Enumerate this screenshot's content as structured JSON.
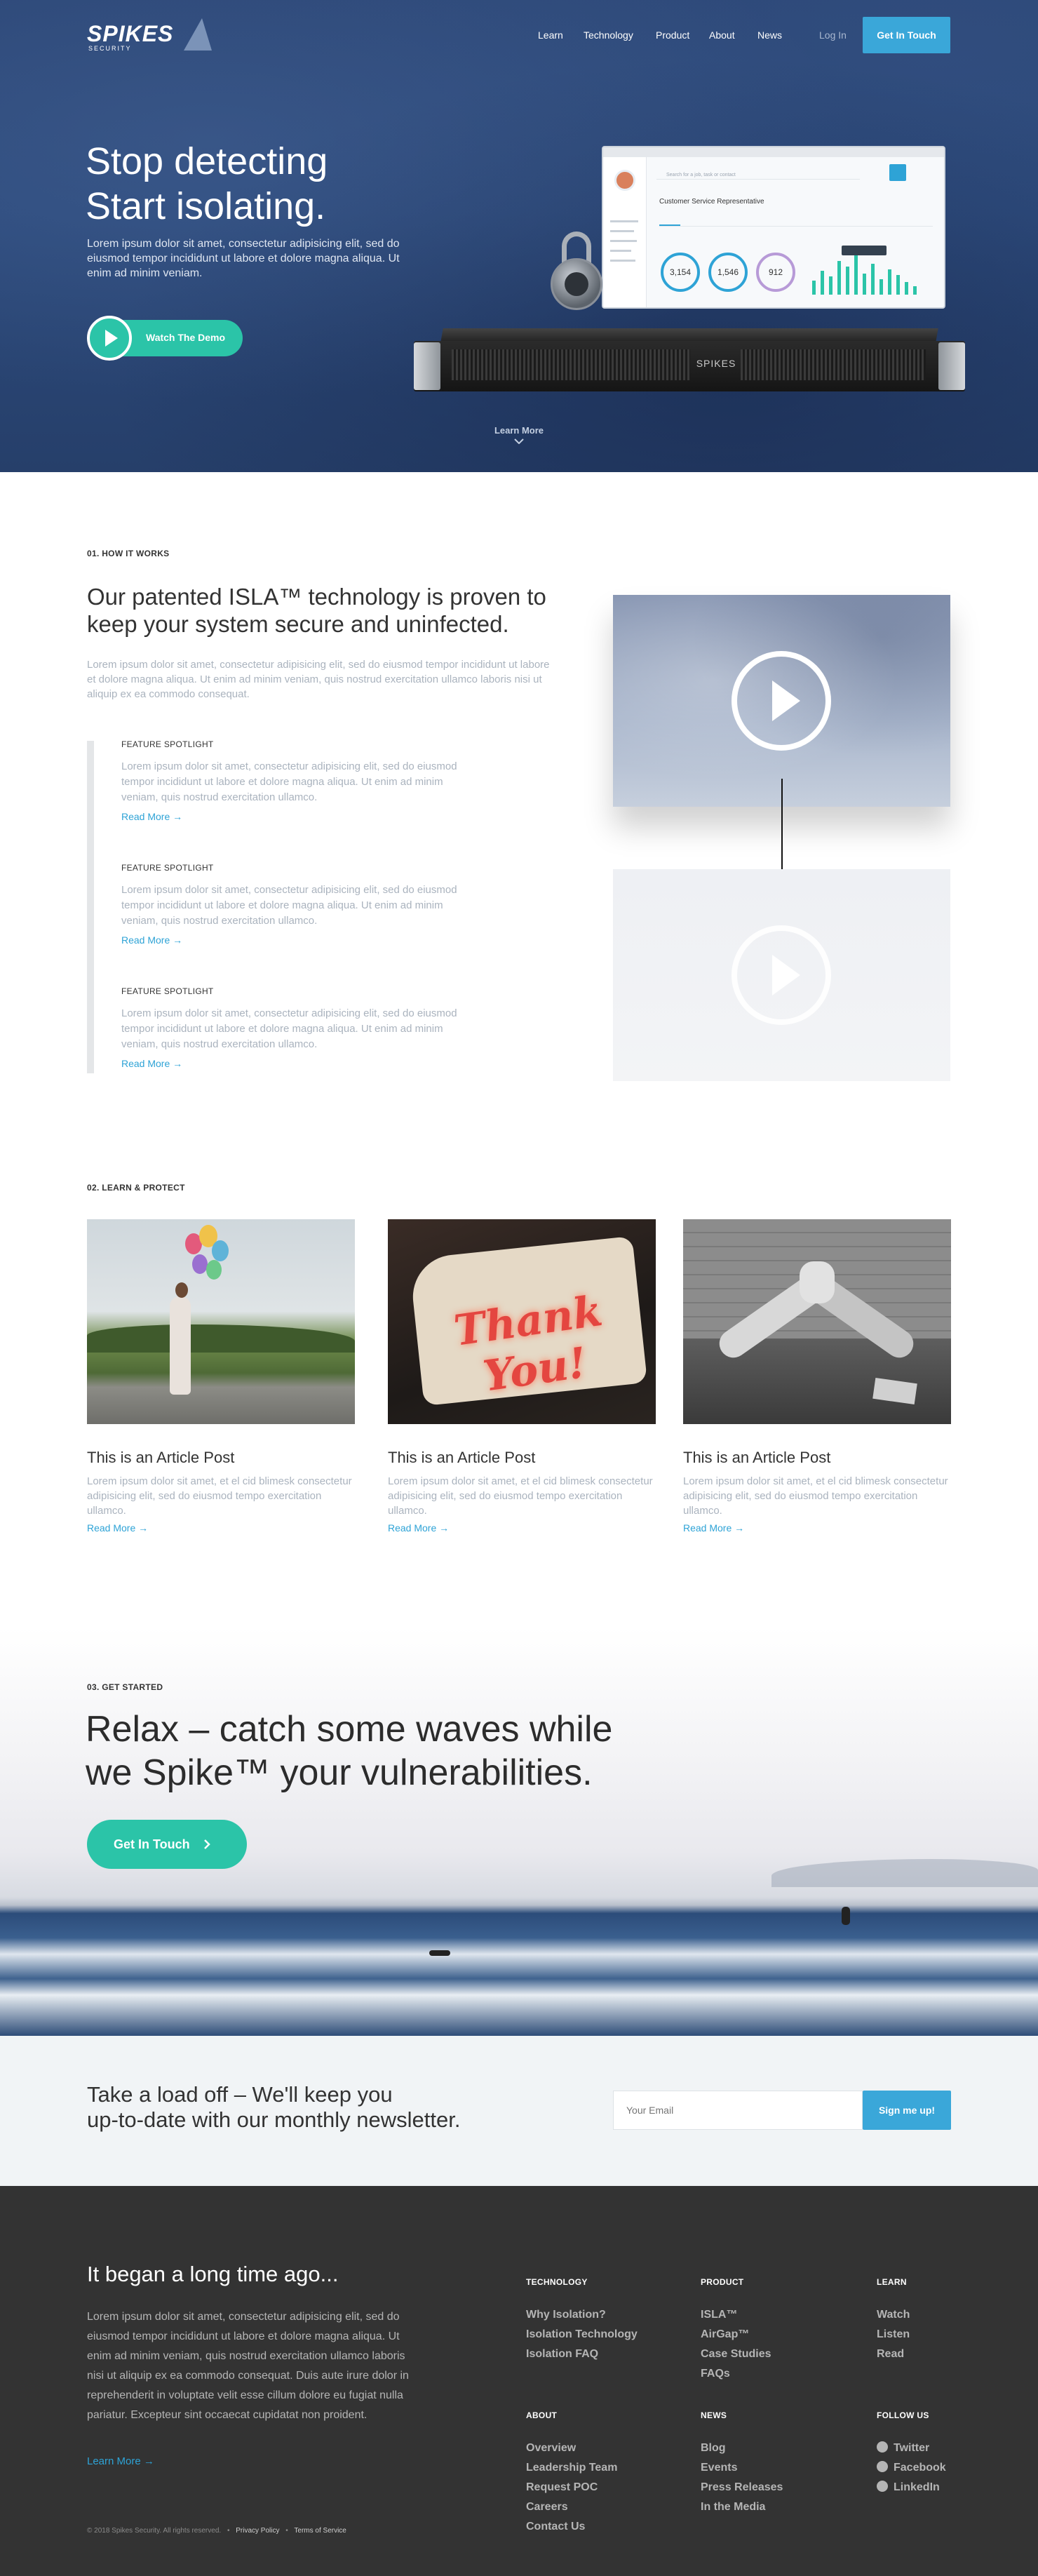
{
  "brand": {
    "name": "SPIKES",
    "sub": "SECURITY"
  },
  "nav": {
    "items": [
      "Learn",
      "Technology",
      "Product",
      "About",
      "News"
    ],
    "login": "Log In",
    "cta": "Get In Touch"
  },
  "hero": {
    "title1": "Stop detecting",
    "title2": "Start isolating.",
    "lead": "Lorem ipsum dolor sit amet, consectetur adipisicing elit, sed do eiusmod tempor incididunt ut labore et dolore magna aliqua. Ut enim ad minim veniam.",
    "demo": "Watch The Demo",
    "learn_more": "Learn More",
    "app": {
      "search": "Search for a job, task or contact",
      "title": "Customer Service Representative",
      "stats": [
        "3,154",
        "1,546",
        "912"
      ],
      "device_label": "SPIKES"
    }
  },
  "how": {
    "label": "01. HOW IT WORKS",
    "title": "Our patented ISLA™ technology is proven to keep your system secure and uninfected.",
    "body": "Lorem ipsum dolor sit amet, consectetur adipisicing elit, sed do eiusmod tempor incididunt ut labore et dolore magna aliqua. Ut enim ad minim veniam, quis nostrud exercitation ullamco laboris nisi ut aliquip ex ea commodo consequat.",
    "features": [
      {
        "title": "FEATURE SPOTLIGHT",
        "body": "Lorem ipsum dolor sit amet, consectetur adipisicing elit, sed do eiusmod tempor incididunt ut labore et dolore magna aliqua. Ut enim ad minim veniam, quis nostrud exercitation ullamco.",
        "link": "Read More →"
      },
      {
        "title": "FEATURE SPOTLIGHT",
        "body": "Lorem ipsum dolor sit amet, consectetur adipisicing elit, sed do eiusmod tempor incididunt ut labore et dolore magna aliqua. Ut enim ad minim veniam, quis nostrud exercitation ullamco.",
        "link": "Read More →"
      },
      {
        "title": "FEATURE SPOTLIGHT",
        "body": "Lorem ipsum dolor sit amet, consectetur adipisicing elit, sed do eiusmod tempor incididunt ut labore et dolore magna aliqua. Ut enim ad minim veniam, quis nostrud exercitation ullamco.",
        "link": "Read More →"
      }
    ]
  },
  "learn": {
    "label": "02. LEARN & PROTECT",
    "articles": [
      {
        "title": "This is an Article Post",
        "body": "Lorem ipsum dolor sit amet, et el cid blimesk consectetur adipisicing elit, sed do eiusmod tempo exercitation ullamco.",
        "link": "Read More →"
      },
      {
        "title": "This is an Article Post",
        "body": "Lorem ipsum dolor sit amet, et el cid blimesk consectetur adipisicing elit, sed do eiusmod tempo exercitation ullamco.",
        "link": "Read More →",
        "sign": "Thank You!"
      },
      {
        "title": "This is an Article Post",
        "body": "Lorem ipsum dolor sit amet, et el cid blimesk consectetur adipisicing elit, sed do eiusmod tempo exercitation ullamco.",
        "link": "Read More →"
      }
    ]
  },
  "started": {
    "label": "03. GET STARTED",
    "line1": "Relax – catch some waves while",
    "line2": "we Spike™ your vulnerabilities.",
    "cta": "Get In Touch"
  },
  "newsletter": {
    "line1": "Take a load off – We'll keep you",
    "line2": "up-to-date with our monthly newsletter.",
    "placeholder": "Your Email",
    "button": "Sign me up!"
  },
  "footer": {
    "title": "It began a long time ago...",
    "body": "Lorem ipsum dolor sit amet, consectetur adipisicing elit, sed do eiusmod tempor incididunt ut labore et dolore magna aliqua. Ut enim ad minim veniam, quis nostrud exercitation ullamco laboris nisi ut aliquip ex ea commodo consequat. Duis aute irure dolor in reprehenderit in voluptate velit esse cillum dolore eu fugiat nulla pariatur. Excepteur sint occaecat cupidatat non proident.",
    "link": "Learn More →",
    "copyright": "© 2018 Spikes Security. All rights reserved.",
    "privacy": "Privacy Policy",
    "terms": "Terms of Service",
    "columns": [
      {
        "head": "TECHNOLOGY",
        "items": [
          "Why Isolation?",
          "Isolation Technology",
          "Isolation FAQ"
        ]
      },
      {
        "head": "PRODUCT",
        "items": [
          "ISLA™",
          "AirGap™",
          "Case Studies",
          "FAQs"
        ]
      },
      {
        "head": "LEARN",
        "items": [
          "Watch",
          "Listen",
          "Read"
        ]
      },
      {
        "head": "ABOUT",
        "items": [
          "Overview",
          "Leadership Team",
          "Request POC",
          "Careers",
          "Contact Us"
        ]
      },
      {
        "head": "NEWS",
        "items": [
          "Blog",
          "Events",
          "Press Releases",
          "In the Media"
        ]
      },
      {
        "head": "FOLLOW US",
        "items": [
          "Twitter",
          "Facebook",
          "LinkedIn"
        ]
      }
    ]
  },
  "colors": {
    "hero": "#2b4676",
    "accent": "#3aa7d9",
    "teal": "#2bc4a8",
    "footer": "#333333"
  }
}
